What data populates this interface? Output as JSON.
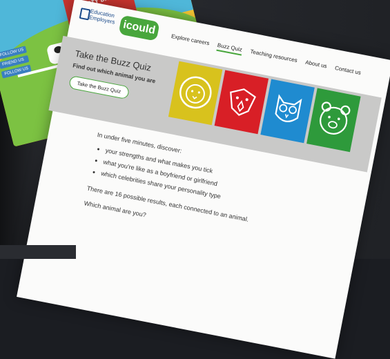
{
  "background_site": {
    "barn_sign": "TASTY DAIRY",
    "follow_tags": [
      "FOLLOW US",
      "FRIEND US",
      "FOLLOW US"
    ]
  },
  "header": {
    "partner_logo_text": "Education Employers",
    "brand": "icould",
    "nav": [
      {
        "label": "Explore careers",
        "active": false
      },
      {
        "label": "Buzz Quiz",
        "active": true
      },
      {
        "label": "Teaching resources",
        "active": false
      },
      {
        "label": "About us",
        "active": false
      },
      {
        "label": "Contact us",
        "active": false
      }
    ]
  },
  "banner": {
    "title": "Take the Buzz Quiz",
    "subtitle": "Find out which animal you are",
    "button_label": "Take the Buzz Quiz",
    "tiles": [
      {
        "animal": "lion-icon",
        "color": "#d8c21d"
      },
      {
        "animal": "eagle-icon",
        "color": "#d81f26"
      },
      {
        "animal": "owl-icon",
        "color": "#1f8bd0"
      },
      {
        "animal": "bear-icon",
        "color": "#2e9a3b"
      }
    ]
  },
  "content": {
    "intro": "In under five minutes, discover:",
    "bullets": [
      "your strengths and what makes you tick",
      "what you're like as a boyfriend or girlfriend",
      "which celebrities share your personality type"
    ],
    "results": "There are 16 possible results, each connected to an animal.",
    "question": "Which animal are you?"
  },
  "colors": {
    "brand_green": "#48a63c",
    "banner_grey": "#c9c9c8"
  }
}
